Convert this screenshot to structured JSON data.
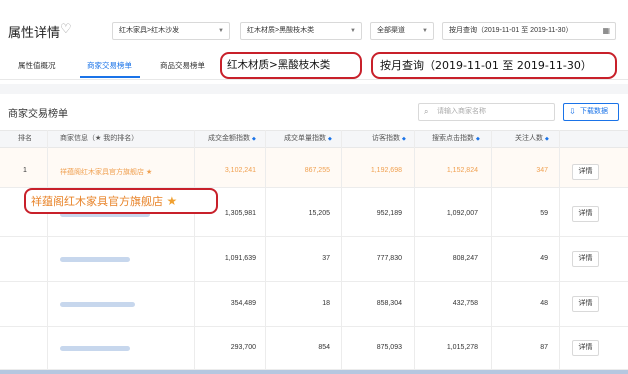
{
  "header": {
    "title": "属性详情",
    "selectors": {
      "category": "红木家具>红木沙发",
      "attribute": "红木材质>黑酸枝木类",
      "channel": "全部渠道",
      "date": "按月查询（2019-11-01 至 2019-11-30）"
    }
  },
  "tabs": [
    "属性值概况",
    "商家交易榜单",
    "商品交易榜单"
  ],
  "callouts": {
    "attribute": "红木材质>黑酸枝木类",
    "date": "按月查询（2019-11-01 至 2019-11-30）",
    "shop": "祥蕴阁红木家具官方旗舰店"
  },
  "section": {
    "title": "商家交易榜单",
    "search_placeholder": "请输入商家名称",
    "download_label": "下载数据"
  },
  "table": {
    "columns": [
      "排名",
      "商家信息（★ 我的排名）",
      "成交金额指数",
      "成交单量指数",
      "访客指数",
      "搜索点击指数",
      "关注人数"
    ],
    "action_label": "详情",
    "rows": [
      {
        "rank": "1",
        "shop": "祥蕴阁红木家具官方旗舰店",
        "amount": "3,102,241",
        "orders": "867,255",
        "visitors": "1,192,698",
        "clicks": "1,152,824",
        "followers": "347",
        "highlight": true
      },
      {
        "rank": "",
        "shop": "",
        "amount": "1,305,981",
        "orders": "15,205",
        "visitors": "952,189",
        "clicks": "1,092,007",
        "followers": "59"
      },
      {
        "rank": "",
        "shop": "",
        "amount": "1,091,639",
        "orders": "37",
        "visitors": "777,830",
        "clicks": "808,247",
        "followers": "49"
      },
      {
        "rank": "",
        "shop": "",
        "amount": "354,489",
        "orders": "18",
        "visitors": "858,304",
        "clicks": "432,758",
        "followers": "48"
      },
      {
        "rank": "",
        "shop": "",
        "amount": "293,700",
        "orders": "854",
        "visitors": "875,093",
        "clicks": "1,015,278",
        "followers": "87"
      }
    ]
  },
  "colors": {
    "accent": "#1a73e8",
    "highlight_text": "#f0a050",
    "callout_border": "#c8202a",
    "callout_shop_text": "#e8842a"
  }
}
